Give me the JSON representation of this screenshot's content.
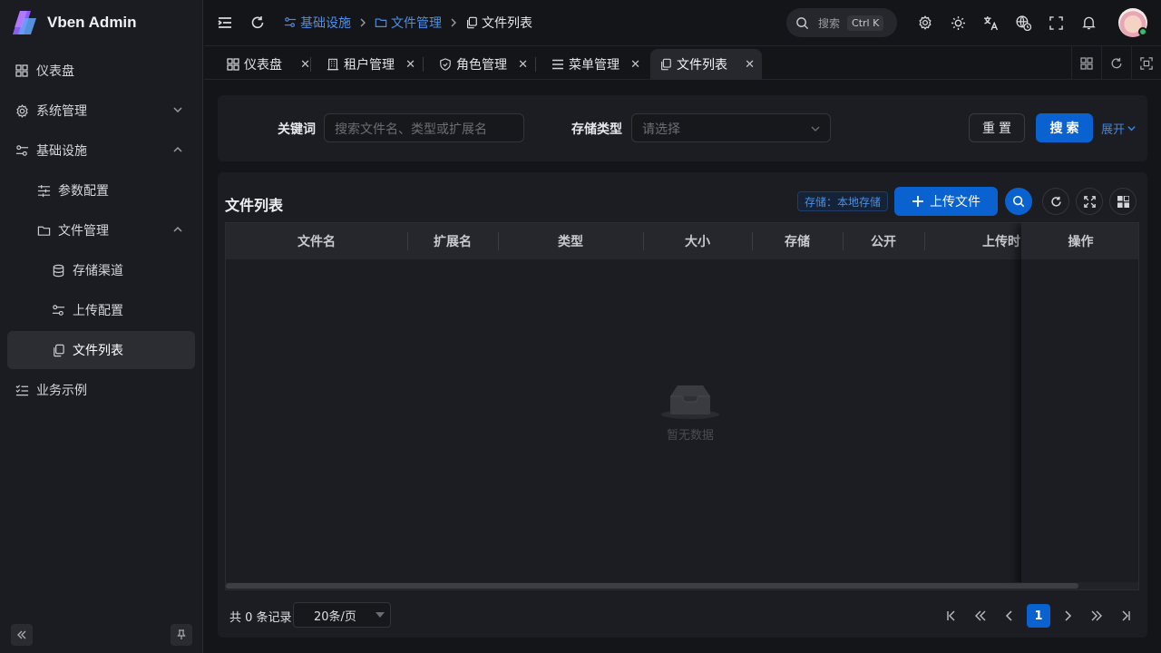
{
  "app": {
    "title": "Vben Admin"
  },
  "sidebar": {
    "items": [
      {
        "label": "仪表盘",
        "icon": "dashboard-icon"
      },
      {
        "label": "系统管理",
        "icon": "gear-icon"
      },
      {
        "label": "基础设施",
        "icon": "sliders-icon"
      },
      {
        "label": "参数配置",
        "icon": "settings-list-icon"
      },
      {
        "label": "文件管理",
        "icon": "folder-icon"
      },
      {
        "label": "存储渠道",
        "icon": "database-icon"
      },
      {
        "label": "上传配置",
        "icon": "sliders-icon"
      },
      {
        "label": "文件列表",
        "icon": "files-icon",
        "active": true
      },
      {
        "label": "业务示例",
        "icon": "checklist-icon"
      }
    ],
    "collapse_icon": "double-chevron-left-icon",
    "pin_icon": "pin-icon"
  },
  "header": {
    "breadcrumb": [
      {
        "label": "基础设施",
        "icon": "sliders-icon"
      },
      {
        "label": "文件管理",
        "icon": "folder-icon"
      },
      {
        "label": "文件列表",
        "icon": "files-icon"
      }
    ],
    "search": {
      "placeholder": "搜索",
      "shortcut": "Ctrl K"
    }
  },
  "tabs": [
    {
      "label": "仪表盘",
      "icon": "dashboard-icon"
    },
    {
      "label": "租户管理",
      "icon": "building-icon"
    },
    {
      "label": "角色管理",
      "icon": "shield-icon"
    },
    {
      "label": "菜单管理",
      "icon": "menu-icon"
    },
    {
      "label": "文件列表",
      "icon": "files-icon",
      "active": true
    }
  ],
  "form": {
    "keyword_label": "关键词",
    "keyword_placeholder": "搜索文件名、类型或扩展名",
    "storage_label": "存储类型",
    "storage_placeholder": "请选择",
    "reset_label": "重置",
    "search_label": "搜索",
    "expand_label": "展开"
  },
  "grid": {
    "title": "文件列表",
    "storage_tag": "存储：本地存储",
    "upload_label": "上传文件",
    "columns": [
      "文件名",
      "扩展名",
      "类型",
      "大小",
      "存储",
      "公开",
      "上传时间",
      "操作"
    ],
    "empty_text": "暂无数据"
  },
  "pager": {
    "total": "共 0 条记录",
    "page_size": "20条/页",
    "current_page": "1"
  },
  "colors": {
    "primary": "#0a62d0",
    "link": "#4d8fe8",
    "background": "#141519",
    "card": "#1c1d22"
  }
}
